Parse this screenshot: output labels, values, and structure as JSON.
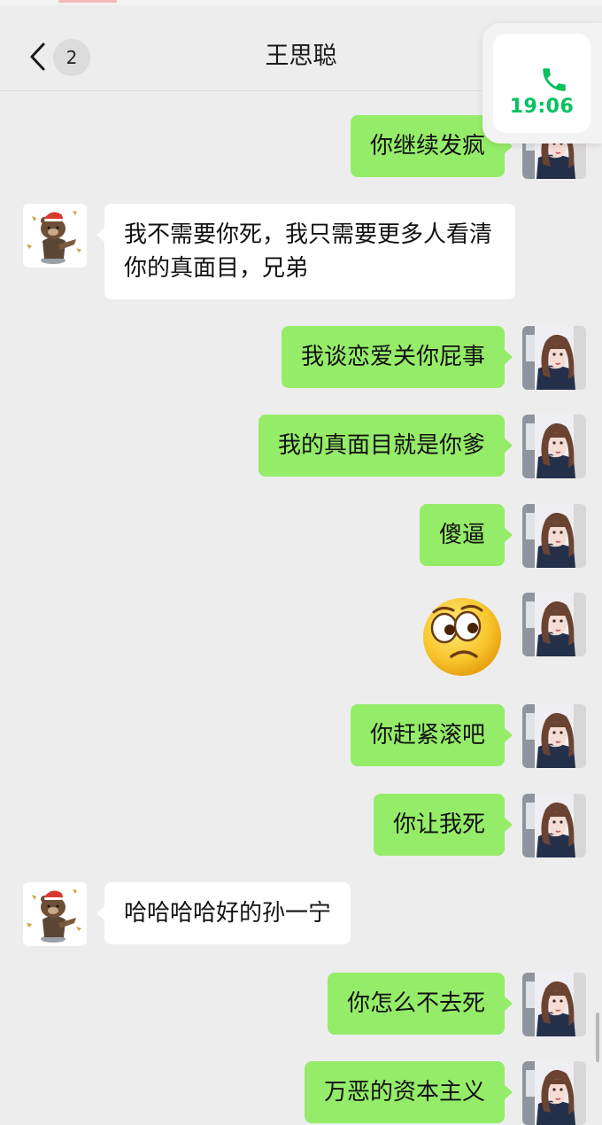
{
  "header": {
    "title": "王思聪",
    "unread_count": "2",
    "back_icon": "chevron-left-icon"
  },
  "call_float": {
    "icon": "phone-icon",
    "time": "19:06",
    "color": "#07c160"
  },
  "colors": {
    "my_bubble": "#95ec69",
    "friend_bubble": "#ffffff",
    "background": "#ededed"
  },
  "messages": [
    {
      "sender": "me",
      "text": "你继续发疯"
    },
    {
      "sender": "friend",
      "text": "我不需要你死，我只需要更多人看清你的真面目，兄弟"
    },
    {
      "sender": "me",
      "text": "我谈恋爱关你屁事"
    },
    {
      "sender": "me",
      "text": "我的真面目就是你爹"
    },
    {
      "sender": "me",
      "text": "傻逼"
    },
    {
      "sender": "me",
      "type": "emoji",
      "emoji": "confused-face-icon"
    },
    {
      "sender": "me",
      "text": "你赶紧滚吧"
    },
    {
      "sender": "me",
      "text": "你让我死"
    },
    {
      "sender": "friend",
      "text": "哈哈哈哈好的孙一宁"
    },
    {
      "sender": "me",
      "text": "你怎么不去死"
    },
    {
      "sender": "me",
      "text": "万恶的资本主义"
    }
  ]
}
